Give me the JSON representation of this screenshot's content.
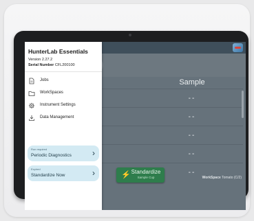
{
  "drawer": {
    "title": "HunterLab Essentials",
    "version": "Version 2.27.2",
    "serial_label": "Serial Number",
    "serial_value": "CFL200100",
    "nav_items": [
      {
        "label": "Jobs",
        "icon": "document-icon"
      },
      {
        "label": "WorkSpaces",
        "icon": "folder-icon"
      },
      {
        "label": "Instrument Settings",
        "icon": "gear-icon"
      },
      {
        "label": "Data Management",
        "icon": "download-icon"
      }
    ],
    "alerts": [
      {
        "status": "Run required",
        "label": "Periodic Diagnostics",
        "icon": "chevron-right-icon"
      },
      {
        "status": "Expired",
        "label": "Standardize Now",
        "icon": "chevron-right-icon"
      }
    ]
  },
  "table": {
    "column_header": "Sample",
    "rows": [
      "--",
      "--",
      "--",
      "--",
      "--"
    ]
  },
  "standardize": {
    "label": "Standardize",
    "sublabel": "Sample Cup",
    "icon": "lightning-bolt-icon",
    "color": "#2e7d4c"
  },
  "footer": {
    "workspace_label": "WorkSpace",
    "workspace_value": "Tomato (C/2)"
  },
  "appbar": {
    "logo_icon": "hunterlab-logo-icon"
  }
}
